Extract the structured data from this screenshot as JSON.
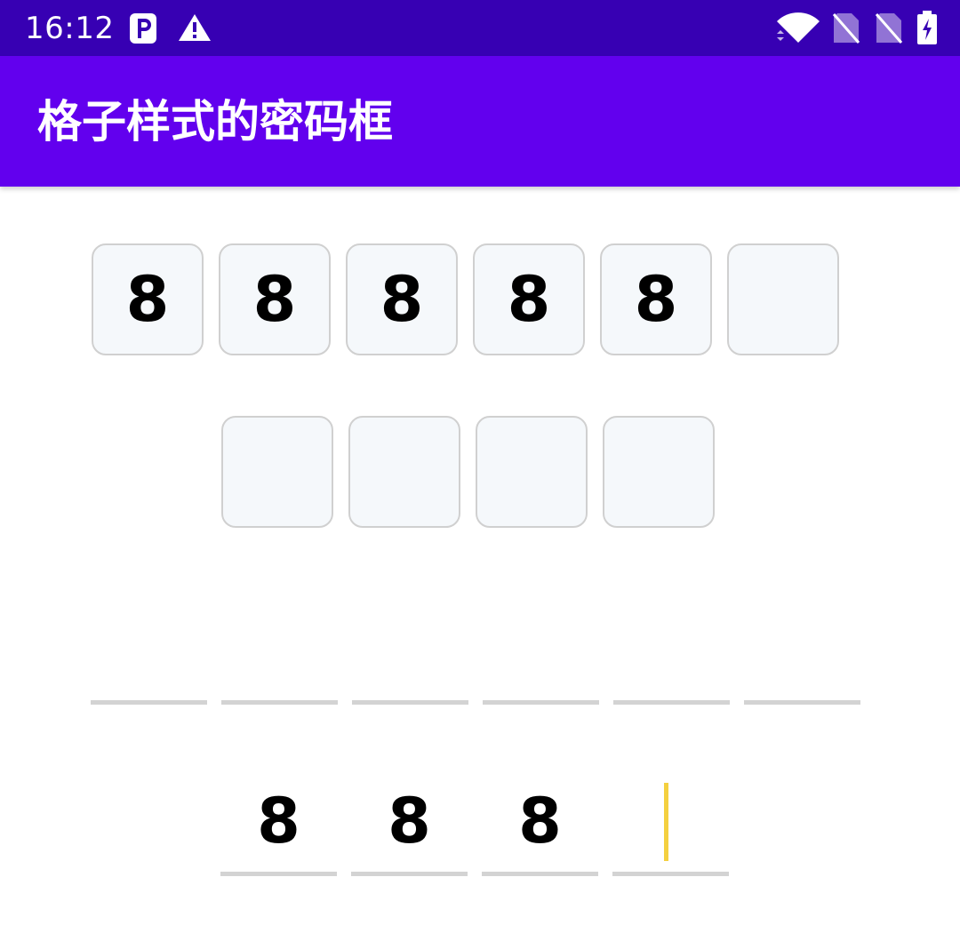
{
  "status_bar": {
    "time": "16:12",
    "icons": [
      "parking-icon",
      "warning-icon",
      "wifi-icon",
      "no-sim-icon",
      "no-sim-icon",
      "battery-charging-icon"
    ]
  },
  "app_bar": {
    "title": "格子样式的密码框"
  },
  "box_input": {
    "row1": [
      "8",
      "8",
      "8",
      "8",
      "8",
      ""
    ],
    "row2": [
      "",
      "",
      "",
      ""
    ]
  },
  "line_input": {
    "row1": [
      "",
      "",
      "",
      "",
      "",
      ""
    ],
    "row2": [
      "8",
      "8",
      "8",
      ""
    ],
    "cursor_index": 3
  },
  "colors": {
    "status_bar": "#3700b3",
    "app_bar": "#6200ee",
    "box_fill": "#f5f8fb",
    "box_border": "#d0d0d0",
    "underline": "#d3d3d3",
    "cursor": "#f4d03f"
  }
}
